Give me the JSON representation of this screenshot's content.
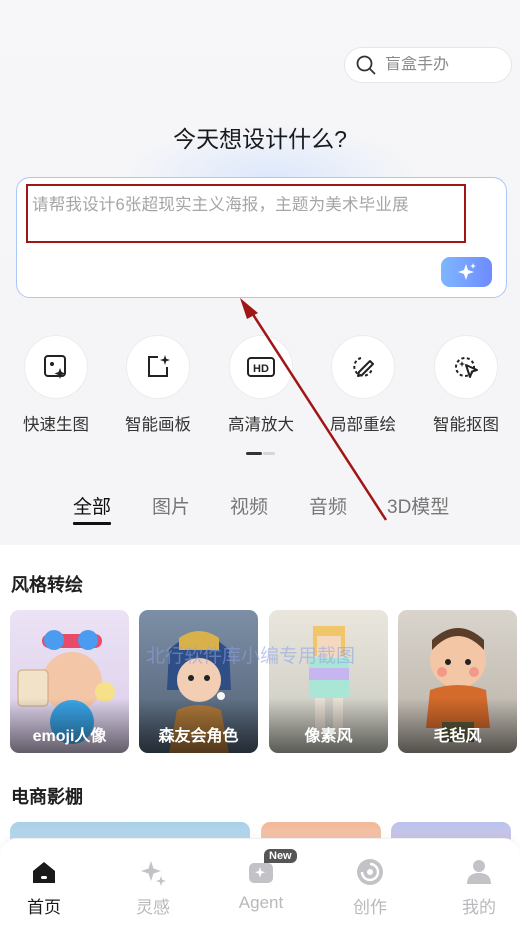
{
  "search": {
    "placeholder": "盲盒手办",
    "icon": "search-icon"
  },
  "headline": "今天想设计什么?",
  "prompt": {
    "placeholder": "请帮我设计6张超现实主义海报，主题为美术毕业展",
    "generate_icon": "sparkle-icon"
  },
  "tools": [
    {
      "label": "快速生图",
      "icon": "quick-image-icon"
    },
    {
      "label": "智能画板",
      "icon": "smart-canvas-icon"
    },
    {
      "label": "高清放大",
      "icon": "hd-icon"
    },
    {
      "label": "局部重绘",
      "icon": "partial-redraw-icon"
    },
    {
      "label": "智能抠图",
      "icon": "smart-cutout-icon"
    }
  ],
  "tabs": [
    {
      "label": "全部",
      "active": true
    },
    {
      "label": "图片"
    },
    {
      "label": "视频"
    },
    {
      "label": "音频"
    },
    {
      "label": "3D模型"
    }
  ],
  "sections": {
    "style": {
      "title": "风格转绘",
      "cards": [
        {
          "label": "emoji人像"
        },
        {
          "label": "森友会角色"
        },
        {
          "label": "像素风"
        },
        {
          "label": "毛毡风"
        }
      ]
    },
    "ecommerce": {
      "title": "电商影棚"
    }
  },
  "watermark": "北行软件库小编专用截图",
  "nav": [
    {
      "label": "首页",
      "icon": "home-icon",
      "active": true
    },
    {
      "label": "灵感",
      "icon": "sparkles-icon"
    },
    {
      "label": "Agent",
      "icon": "agent-icon",
      "badge": "New"
    },
    {
      "label": "创作",
      "icon": "create-icon"
    },
    {
      "label": "我的",
      "icon": "user-icon"
    }
  ],
  "colors": {
    "accent": "#6e8bff",
    "annotation": "#a01616",
    "prompt_border": "#a9c8f7"
  }
}
